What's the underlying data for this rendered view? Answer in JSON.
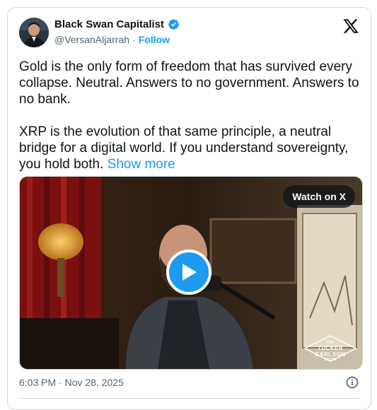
{
  "author": {
    "display_name": "Black Swan Capitalist",
    "handle": "@VersanAljarrah",
    "separator": "·",
    "follow_label": "Follow"
  },
  "post": {
    "text": "Gold is the only form of freedom that has survived every collapse. Neutral. Answers to no government. Answers to no bank.\n\nXRP is the evolution of that same principle, a neutral bridge for a digital world. If you understand sovereignty, you hold both. ",
    "show_more_label": "Show more"
  },
  "media": {
    "watch_label": "Watch on X",
    "show_logo": {
      "line1": "THE",
      "line2": "TUCKER",
      "line3": "CARLSON",
      "line4": "SHOW"
    }
  },
  "footer": {
    "timestamp": "6:03 PM · Nov 28, 2025"
  },
  "icons": {
    "verified": "verified-badge-icon",
    "x_logo": "x-logo-icon",
    "play": "play-icon",
    "info": "info-icon"
  },
  "colors": {
    "accent": "#1d9bf0",
    "text": "#0f1419",
    "secondary": "#536471",
    "border": "#cfd9de"
  }
}
